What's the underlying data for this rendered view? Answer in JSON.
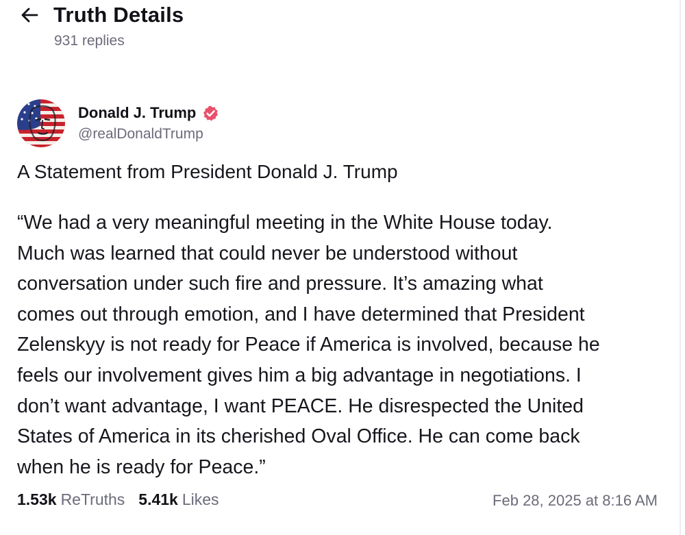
{
  "header": {
    "title": "Truth Details",
    "replies": "931 replies",
    "back_icon": "arrow-left-icon"
  },
  "post": {
    "author": {
      "display_name": "Donald J. Trump",
      "handle": "@realDonaldTrump",
      "verified": true,
      "verified_color": "#e9506a"
    },
    "headline": "A Statement from President Donald J. Trump",
    "body_lines": [
      "“We had a very meaningful meeting in the White House today.",
      "Much was learned that could never be understood without",
      "conversation under such fire and pressure. It’s amazing what",
      "comes out through emotion, and I have determined that President",
      "Zelenskyy is not ready for Peace if America is involved, because he",
      "feels our involvement gives him a big advantage in negotiations. I",
      "don’t want advantage, I want PEACE. He disrespected the United",
      "States of America in its cherished Oval Office. He can come back",
      "when he is ready for Peace.”"
    ],
    "stats": {
      "retruths_count": "1.53k",
      "retruths_label": "ReTruths",
      "likes_count": "5.41k",
      "likes_label": "Likes"
    },
    "timestamp": "Feb 28, 2025 at 8:16 AM"
  }
}
